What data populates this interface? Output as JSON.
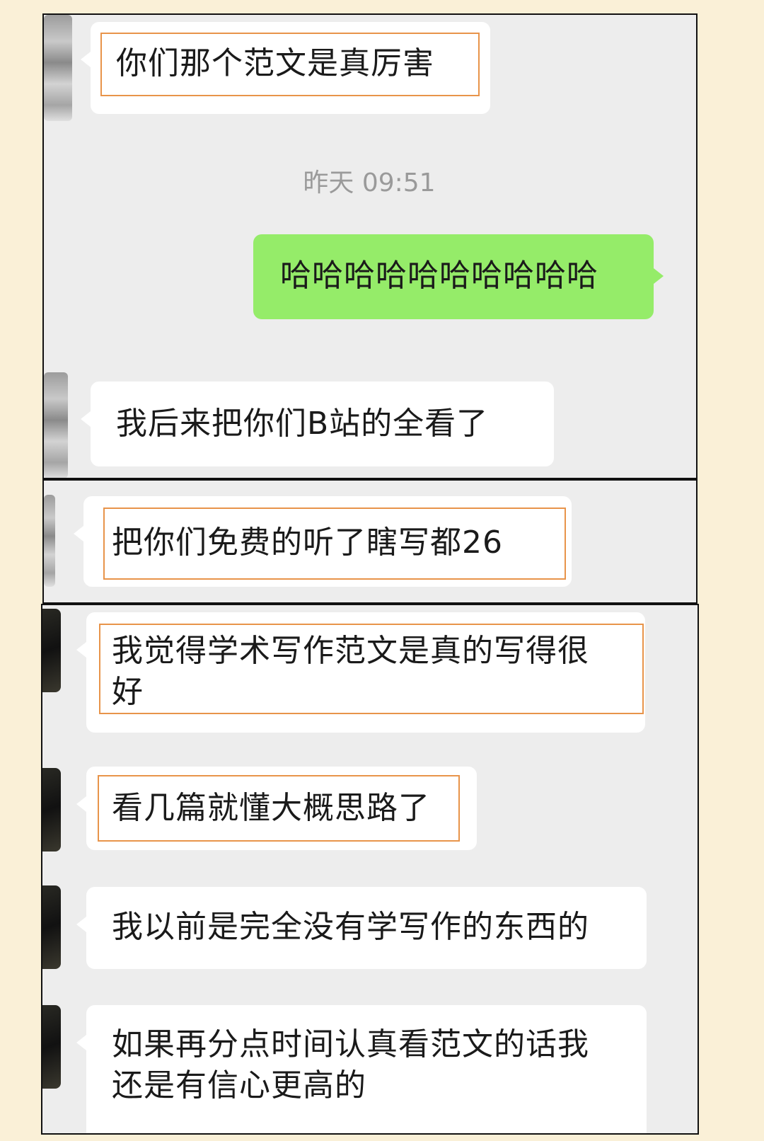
{
  "timestamp": "昨天 09:51",
  "messages": [
    "你们那个范文是真厉害",
    "哈哈哈哈哈哈哈哈哈哈",
    "我后来把你们B站的全看了",
    "把你们免费的听了瞎写都26",
    "我觉得学术写作范文是真的写得很\n好",
    "看几篇就懂大概思路了",
    "我以前是完全没有学写作的东西的",
    "如果再分点时间认真看范文的话我\n还是有信心更高的"
  ],
  "colors": {
    "page_background": "#faf0d7",
    "chat_background": "#ededed",
    "incoming_bubble": "#ffffff",
    "outgoing_bubble": "#95ec69",
    "highlight_frame": "#e8944a",
    "timestamp_text": "#9a9a9a"
  }
}
